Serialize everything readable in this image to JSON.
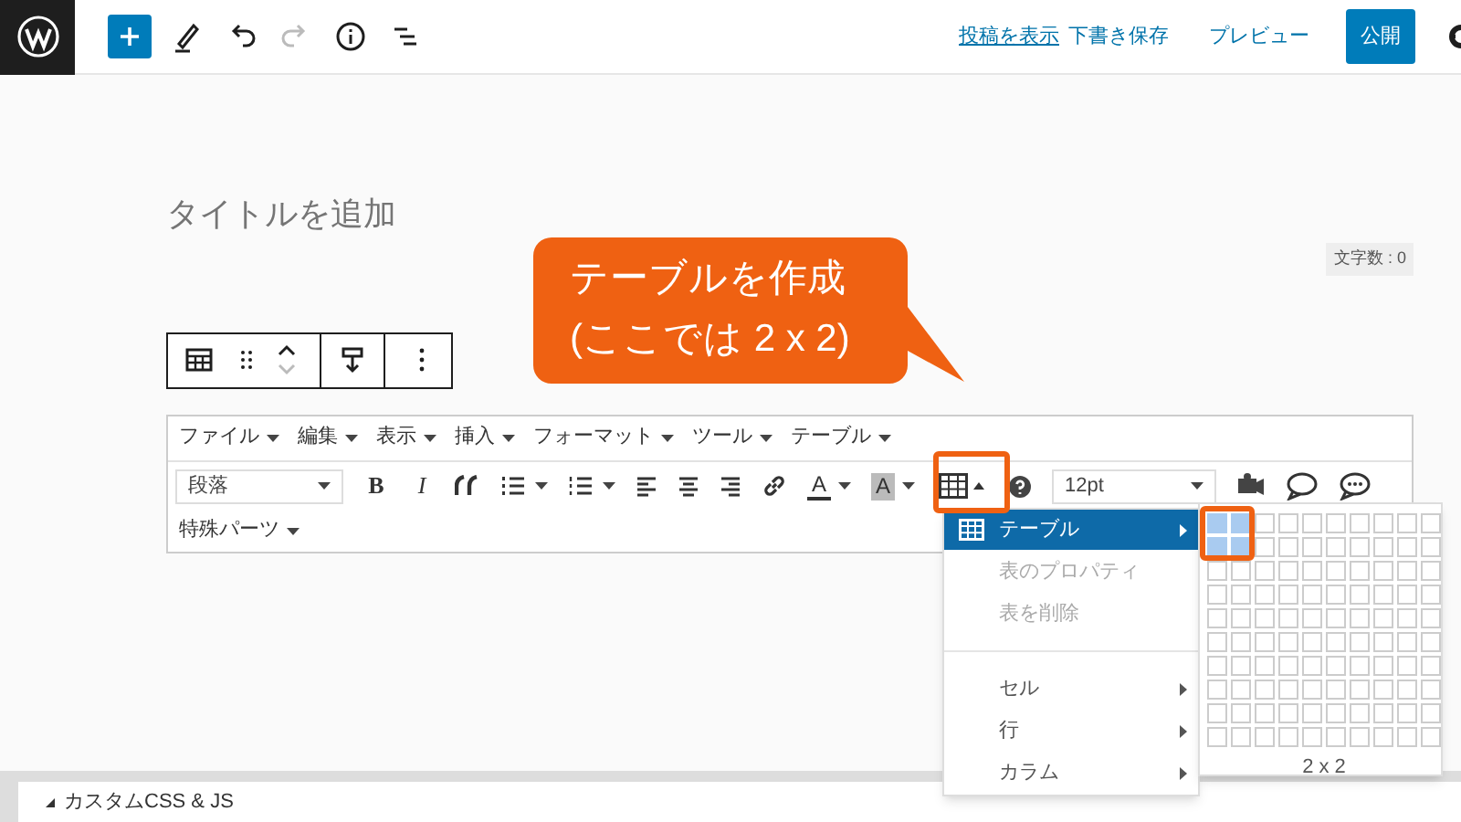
{
  "top_bar": {
    "tools": [
      {
        "kind": "plus",
        "disabled": false
      },
      {
        "kind": "pencil",
        "disabled": false
      },
      {
        "kind": "undo",
        "disabled": false
      },
      {
        "kind": "redo",
        "disabled": true
      },
      {
        "kind": "info",
        "disabled": false
      },
      {
        "kind": "outline",
        "disabled": false
      }
    ],
    "view_post_link": "投稿を表示",
    "save_draft": "下書き保存",
    "preview": "プレビュー",
    "publish": "公開"
  },
  "title_placeholder": "タイトルを追加",
  "word_count": "文字数 : 0",
  "block_toolbar": [
    {
      "kind": "table"
    },
    {
      "kind": "drag"
    },
    {
      "kind": "move"
    },
    {
      "kind": "align"
    },
    {
      "kind": "more"
    }
  ],
  "menu_bar": [
    "ファイル",
    "編集",
    "表示",
    "挿入",
    "フォーマット",
    "ツール",
    "テーブル"
  ],
  "toolbar": [
    {
      "kind": "select",
      "label": "段落"
    },
    {
      "kind": "bold",
      "label": "B"
    },
    {
      "kind": "italic",
      "label": "I"
    },
    {
      "kind": "quote"
    },
    {
      "kind": "bullets"
    },
    {
      "kind": "numbers"
    },
    {
      "kind": "align-left"
    },
    {
      "kind": "align-center"
    },
    {
      "kind": "align-right"
    },
    {
      "kind": "link"
    },
    {
      "kind": "text-color",
      "label": "A"
    },
    {
      "kind": "background-color",
      "label": "A"
    },
    {
      "kind": "table",
      "highlighted": true
    },
    {
      "kind": "help"
    },
    {
      "kind": "select",
      "label": "12pt"
    },
    {
      "kind": "media"
    },
    {
      "kind": "comment"
    },
    {
      "kind": "comment-dots"
    }
  ],
  "special_parts": "特殊パーツ",
  "callout": [
    "テーブルを作成",
    "(ここでは 2 x 2)"
  ],
  "table_menu": [
    {
      "kind": "item",
      "label": "テーブル",
      "selected": true,
      "disabled": false,
      "submenu": true
    },
    {
      "kind": "item",
      "label": "表のプロパティ",
      "selected": false,
      "disabled": true,
      "submenu": false
    },
    {
      "kind": "item",
      "label": "表を削除",
      "selected": false,
      "disabled": true,
      "submenu": false
    },
    {
      "kind": "divider"
    },
    {
      "kind": "item",
      "label": "セル",
      "selected": false,
      "disabled": false,
      "submenu": true
    },
    {
      "kind": "item",
      "label": "行",
      "selected": false,
      "disabled": false,
      "submenu": true
    },
    {
      "kind": "item",
      "label": "カラム",
      "selected": false,
      "disabled": false,
      "submenu": true
    }
  ],
  "table_grid": {
    "rows": [
      [
        true,
        true,
        false,
        false,
        false,
        false,
        false,
        false,
        false,
        false
      ],
      [
        true,
        true,
        false,
        false,
        false,
        false,
        false,
        false,
        false,
        false
      ],
      [
        false,
        false,
        false,
        false,
        false,
        false,
        false,
        false,
        false,
        false
      ],
      [
        false,
        false,
        false,
        false,
        false,
        false,
        false,
        false,
        false,
        false
      ],
      [
        false,
        false,
        false,
        false,
        false,
        false,
        false,
        false,
        false,
        false
      ],
      [
        false,
        false,
        false,
        false,
        false,
        false,
        false,
        false,
        false,
        false
      ],
      [
        false,
        false,
        false,
        false,
        false,
        false,
        false,
        false,
        false,
        false
      ],
      [
        false,
        false,
        false,
        false,
        false,
        false,
        false,
        false,
        false,
        false
      ],
      [
        false,
        false,
        false,
        false,
        false,
        false,
        false,
        false,
        false,
        false
      ],
      [
        false,
        false,
        false,
        false,
        false,
        false,
        false,
        false,
        false,
        false
      ]
    ],
    "size_label": "2 x 2"
  },
  "bottom_panel": {
    "title": "カスタムCSS & JS"
  }
}
